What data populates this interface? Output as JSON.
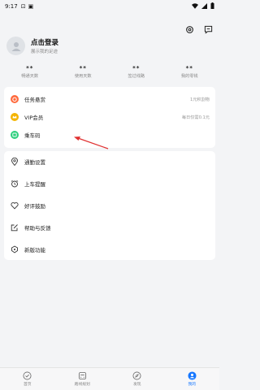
{
  "status": {
    "time": "9:17"
  },
  "profile": {
    "title": "点击登录",
    "subtitle": "展示我的足迹"
  },
  "stats": [
    {
      "value": "**",
      "label": "畅通天数"
    },
    {
      "value": "**",
      "label": "使用天数"
    },
    {
      "value": "**",
      "label": "签过线路"
    },
    {
      "value": "**",
      "label": "我的零钱"
    }
  ],
  "card1": [
    {
      "label": "任务悬赏",
      "right": "1元积割物",
      "icon": "task-icon",
      "color": "#ff6a3d"
    },
    {
      "label": "VIP会员",
      "right": "每日仅需0.1元",
      "icon": "vip-icon",
      "color": "#f4b400"
    },
    {
      "label": "乘车码",
      "right": "",
      "icon": "ride-code-icon",
      "color": "#2ccf7c"
    }
  ],
  "card2": [
    {
      "label": "通勤设置",
      "icon": "location-pin-icon"
    },
    {
      "label": "上车提醒",
      "icon": "alarm-clock-icon"
    },
    {
      "label": "好评鼓励",
      "icon": "heart-icon"
    },
    {
      "label": "帮助与反馈",
      "icon": "edit-icon"
    },
    {
      "label": "新版功能",
      "icon": "shield-icon"
    }
  ],
  "tabs": [
    {
      "label": "首页",
      "active": false
    },
    {
      "label": "路线规划",
      "active": false
    },
    {
      "label": "发现",
      "active": false
    },
    {
      "label": "我的",
      "active": true
    }
  ],
  "colors": {
    "accent": "#1677ff",
    "arrow": "#e03030"
  }
}
